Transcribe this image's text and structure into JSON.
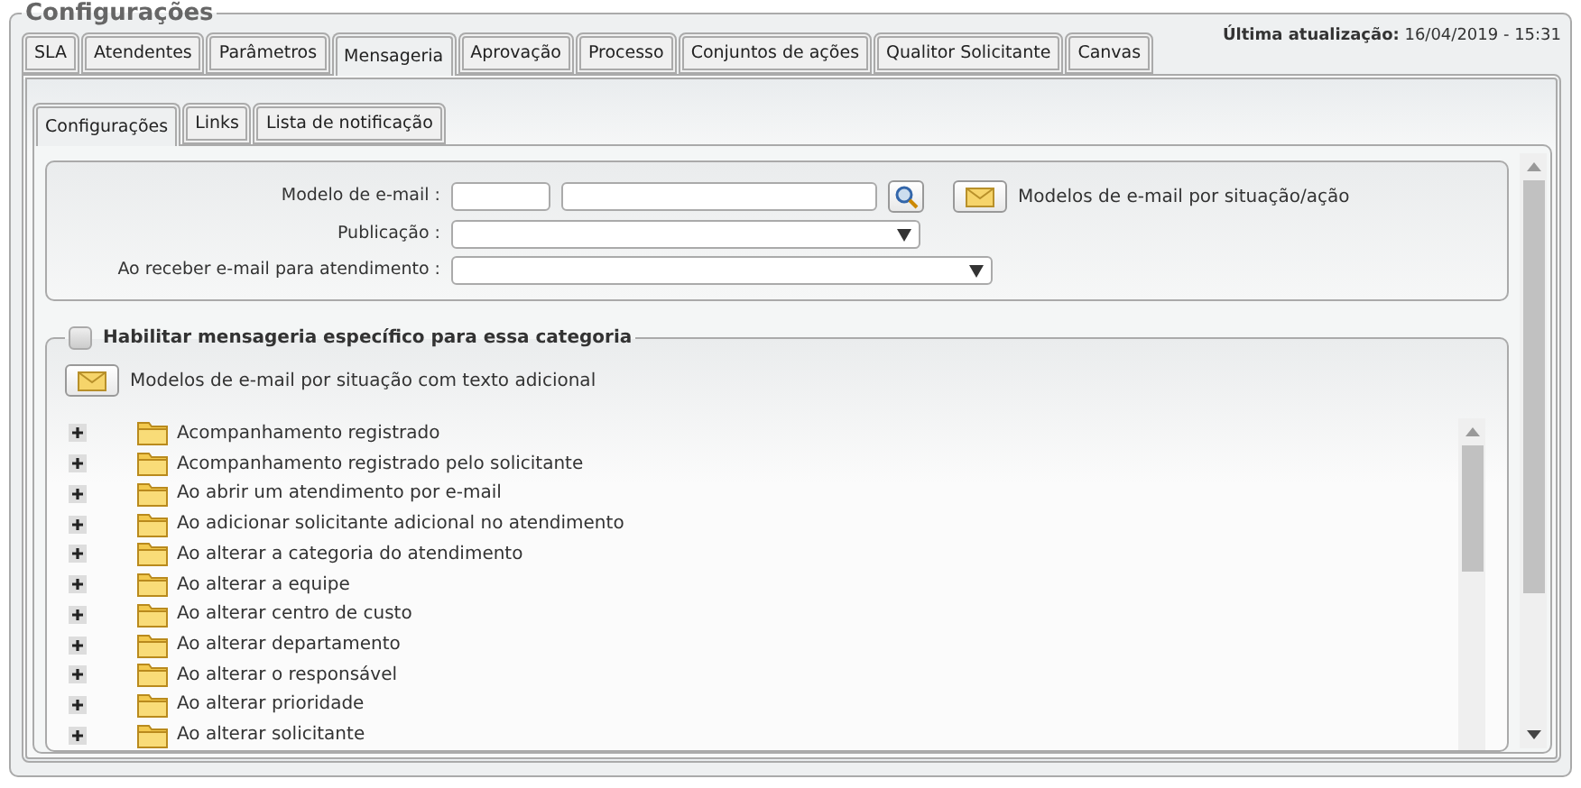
{
  "group_title": "Configurações",
  "tabs": [
    {
      "label": "SLA",
      "selected": false
    },
    {
      "label": "Atendentes",
      "selected": false
    },
    {
      "label": "Parâmetros",
      "selected": false
    },
    {
      "label": "Mensageria",
      "selected": true
    },
    {
      "label": "Aprovação",
      "selected": false
    },
    {
      "label": "Processo",
      "selected": false
    },
    {
      "label": "Conjuntos de ações",
      "selected": false
    },
    {
      "label": "Qualitor Solicitante",
      "selected": false
    },
    {
      "label": "Canvas",
      "selected": false
    }
  ],
  "last_update": "**Última atualização:** 16/04/2019 - 15:31",
  "subtabs": [
    {
      "label": "Configurações",
      "selected": true
    },
    {
      "label": "Links",
      "selected": false
    },
    {
      "label": "Lista de notificação",
      "selected": false
    }
  ],
  "form": {
    "email_model": {
      "label": "Modelo de e-mail :",
      "models_link": "Modelos de e-mail por situação/ação"
    },
    "publication": {
      "label": "Publicação :"
    },
    "on_receive": {
      "label": "Ao receber e-mail para atendimento :"
    }
  },
  "category_messaging": {
    "label": "Habilitar mensageria específico para essa categoria",
    "checked": false,
    "models_link": "Modelos de e-mail por situação com texto adicional",
    "tree": [
      {
        "label": "Acompanhamento registrado",
        "expanded": false
      },
      {
        "label": "Acompanhamento registrado pelo solicitante",
        "expanded": false
      },
      {
        "label": "Ao abrir um atendimento por e-mail",
        "expanded": false
      },
      {
        "label": "Ao adicionar solicitante adicional no atendimento",
        "expanded": false
      },
      {
        "label": "Ao alterar a categoria do atendimento",
        "expanded": false
      },
      {
        "label": "Ao alterar a equipe",
        "expanded": false
      },
      {
        "label": "Ao alterar centro de custo",
        "expanded": false
      },
      {
        "label": "Ao alterar departamento",
        "expanded": false
      },
      {
        "label": "Ao alterar o responsável",
        "expanded": false
      },
      {
        "label": "Ao alterar prioridade",
        "expanded": false
      },
      {
        "label": "Ao alterar solicitante",
        "expanded": false
      }
    ]
  }
}
